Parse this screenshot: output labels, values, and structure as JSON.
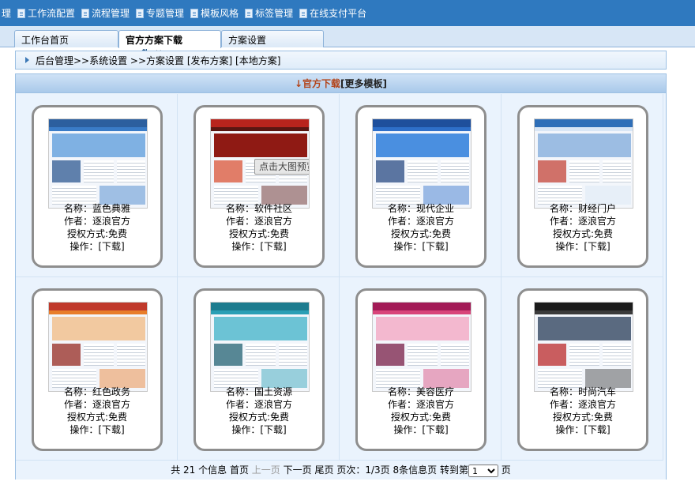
{
  "topmenu": {
    "items": [
      {
        "label": "理",
        "icon": false
      },
      {
        "label": "工作流配置",
        "icon": true
      },
      {
        "label": "流程管理",
        "icon": true
      },
      {
        "label": "专题管理",
        "icon": true
      },
      {
        "label": "模板风格",
        "icon": true
      },
      {
        "label": "标签管理",
        "icon": true
      },
      {
        "label": "在线支付平台",
        "icon": true
      }
    ]
  },
  "tabs": {
    "home": "工作台首页",
    "active": "官方方案下载",
    "refresh": "⇅",
    "close": "×",
    "settings": "方案设置"
  },
  "breadcrumb": "后台管理>>系统设置 >>方案设置 [发布方案] [本地方案]",
  "panel": {
    "title": "↓官方下载",
    "more": "[更多模板]"
  },
  "preview_tip": "点击大图预览",
  "templates": [
    {
      "name": "名称：蓝色典雅",
      "author": "作者：逐浪官方",
      "license": "授权方式:免费",
      "action": "操作：[下载]",
      "theme": "blue"
    },
    {
      "name": "名称：软件社区",
      "author": "作者：逐浪官方",
      "license": "授权方式:免费",
      "action": "操作：[下载]",
      "theme": "red"
    },
    {
      "name": "名称：现代企业",
      "author": "作者：逐浪官方",
      "license": "授权方式:免费",
      "action": "操作：[下载]",
      "theme": "corp"
    },
    {
      "name": "名称：财经门户",
      "author": "作者：逐浪官方",
      "license": "授权方式:免费",
      "action": "操作：[下载]",
      "theme": "finance"
    },
    {
      "name": "名称：红色政务",
      "author": "作者：逐浪官方",
      "license": "授权方式:免费",
      "action": "操作：[下载]",
      "theme": "gov"
    },
    {
      "name": "名称：国土资源",
      "author": "作者：逐浪官方",
      "license": "授权方式:免费",
      "action": "操作：[下载]",
      "theme": "land"
    },
    {
      "name": "名称：美容医疗",
      "author": "作者：逐浪官方",
      "license": "授权方式:免费",
      "action": "操作：[下载]",
      "theme": "beauty"
    },
    {
      "name": "名称：时尚汽车",
      "author": "作者：逐浪官方",
      "license": "授权方式:免费",
      "action": "操作：[下载]",
      "theme": "car"
    }
  ],
  "pager": {
    "total": "共 21 个信息",
    "first": "首页",
    "prev": "上一页",
    "next": "下一页",
    "last": "尾页",
    "pageinfo": "页次：1/3页",
    "perpage": "8条信息页",
    "goto": "转到第",
    "page_value": "1",
    "page_suffix": "页"
  },
  "colors": {
    "menu_bg": "#2f79bf",
    "panel_title": "#b3441a",
    "card_border": "#8e8e8e"
  }
}
